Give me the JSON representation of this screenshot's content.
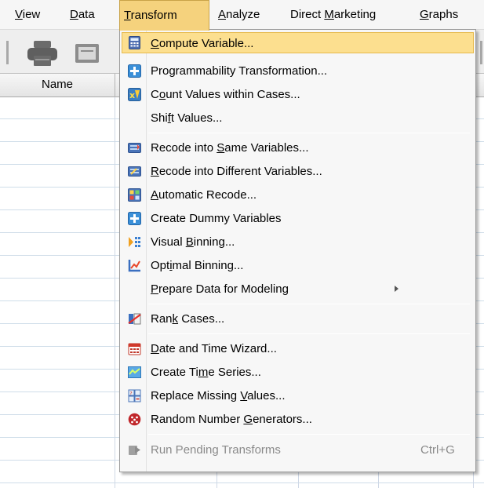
{
  "menubar": {
    "items": [
      {
        "pre": "",
        "acc": "V",
        "post": "iew"
      },
      {
        "pre": "",
        "acc": "D",
        "post": "ata"
      },
      {
        "pre": "",
        "acc": "T",
        "post": "ransform"
      },
      {
        "pre": "",
        "acc": "A",
        "post": "nalyze"
      },
      {
        "pre": "Direct ",
        "acc": "M",
        "post": "arketing"
      },
      {
        "pre": "",
        "acc": "G",
        "post": "raphs"
      }
    ],
    "active_index": 2
  },
  "grid": {
    "header": "Name"
  },
  "menu": {
    "items": [
      {
        "pre": "",
        "acc": "C",
        "post": "ompute Variable...",
        "icon": "compute-variable-icon"
      },
      {
        "pre": "",
        "acc": "",
        "post": "Programmability Transformation...",
        "icon": "programmability-plus-icon"
      },
      {
        "pre": "C",
        "acc": "o",
        "post": "unt Values within Cases...",
        "icon": "count-values-icon"
      },
      {
        "pre": "Shi",
        "acc": "f",
        "post": "t Values...",
        "icon": ""
      },
      {
        "pre": "Recode into ",
        "acc": "S",
        "post": "ame Variables...",
        "icon": "recode-same-icon"
      },
      {
        "pre": "",
        "acc": "R",
        "post": "ecode into Different Variables...",
        "icon": "recode-different-icon"
      },
      {
        "pre": "",
        "acc": "A",
        "post": "utomatic Recode...",
        "icon": "automatic-recode-icon"
      },
      {
        "pre": "",
        "acc": "",
        "post": "Create Dummy Variables",
        "icon": "dummy-variables-plus-icon"
      },
      {
        "pre": "Visual ",
        "acc": "B",
        "post": "inning...",
        "icon": "visual-binning-icon"
      },
      {
        "pre": "Opt",
        "acc": "i",
        "post": "mal Binning...",
        "icon": "optimal-binning-icon"
      },
      {
        "pre": "",
        "acc": "P",
        "post": "repare Data for Modeling",
        "icon": ""
      },
      {
        "pre": "Ran",
        "acc": "k",
        "post": " Cases...",
        "icon": "rank-cases-icon"
      },
      {
        "pre": "",
        "acc": "D",
        "post": "ate and Time Wizard...",
        "icon": "date-time-wizard-icon"
      },
      {
        "pre": "Create Ti",
        "acc": "m",
        "post": "e Series...",
        "icon": "time-series-icon"
      },
      {
        "pre": "Replace Missing ",
        "acc": "V",
        "post": "alues...",
        "icon": "replace-missing-icon"
      },
      {
        "pre": "Random Number ",
        "acc": "G",
        "post": "enerators...",
        "icon": "random-dice-icon"
      },
      {
        "pre": "",
        "acc": "",
        "post": "Run Pending Transforms",
        "icon": "run-pending-icon"
      }
    ],
    "shortcut": "Ctrl+G"
  }
}
